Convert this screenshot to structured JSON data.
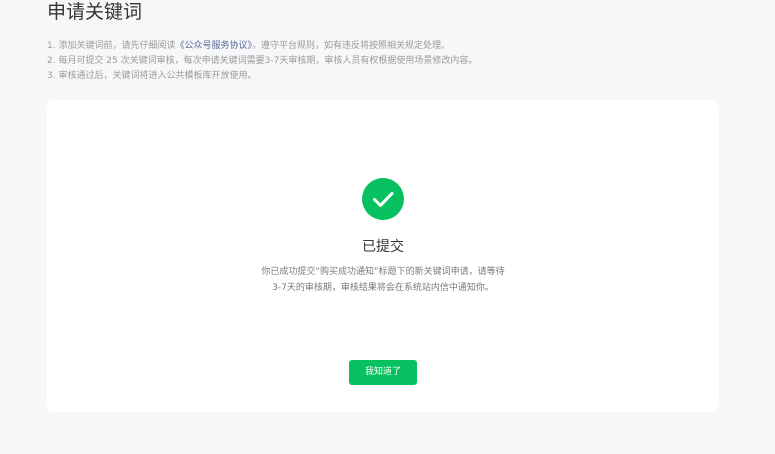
{
  "page": {
    "title": "申请关键词"
  },
  "notes": {
    "line1_prefix": "1. 添加关键词前，请先仔细阅读",
    "line1_link": "《公众号服务协议》",
    "line1_suffix": "，遵守平台规则，如有违反将按照相关规定处理。",
    "line2": "2. 每月可提交 25 次关键词审核，每次申请关键词需要3-7天审核期，审核人员有权根据使用场景修改内容。",
    "line3": "3. 审核通过后，关键词将进入公共模板库开放使用。"
  },
  "result": {
    "icon": "check-circle-icon",
    "title": "已提交",
    "description_line1": "你已成功提交“购买成功通知”标题下的新关键词申请，请等待",
    "description_line2": "3-7天的审核期，审核结果将会在系统站内信中通知你。",
    "button_label": "我知道了"
  },
  "colors": {
    "accent": "#07c160",
    "link": "#576b95",
    "background": "#f6f7f9",
    "card": "#ffffff"
  }
}
